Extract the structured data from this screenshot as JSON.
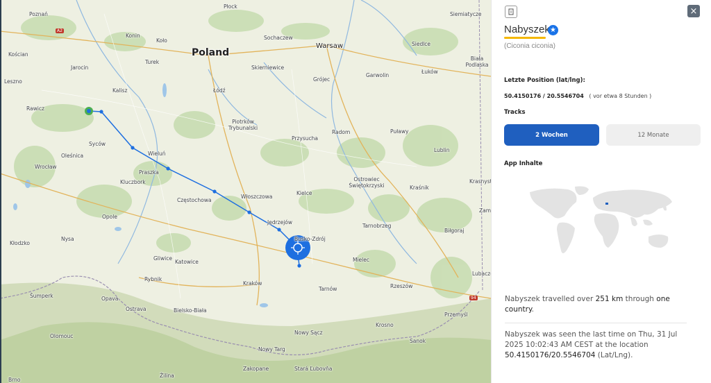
{
  "map": {
    "country_label": "Poland",
    "cities": [
      {
        "name": "Poznań",
        "size": "small"
      },
      {
        "name": "Konin",
        "size": "small"
      },
      {
        "name": "Koło",
        "size": "small"
      },
      {
        "name": "Sochaczew",
        "size": "small"
      },
      {
        "name": "Warsaw",
        "size": "mid"
      },
      {
        "name": "Siedlce",
        "size": "small"
      },
      {
        "name": "Biała Podlaska",
        "size": "small"
      },
      {
        "name": "Kościan",
        "size": "small"
      },
      {
        "name": "Jarocin",
        "size": "small"
      },
      {
        "name": "Turek",
        "size": "small"
      },
      {
        "name": "Skierniewice",
        "size": "small"
      },
      {
        "name": "Garwolin",
        "size": "small"
      },
      {
        "name": "Łuków",
        "size": "small"
      },
      {
        "name": "Leszno",
        "size": "small"
      },
      {
        "name": "Kalisz",
        "size": "small"
      },
      {
        "name": "Łódź",
        "size": "small"
      },
      {
        "name": "Grójec",
        "size": "small"
      },
      {
        "name": "Rawicz",
        "size": "small"
      },
      {
        "name": "Piotrków Trybunalski",
        "size": "small"
      },
      {
        "name": "Radom",
        "size": "small"
      },
      {
        "name": "Puławy",
        "size": "small"
      },
      {
        "name": "Syców",
        "size": "small"
      },
      {
        "name": "Przysucha",
        "size": "small"
      },
      {
        "name": "Oleśnica",
        "size": "small"
      },
      {
        "name": "Wieluń",
        "size": "small"
      },
      {
        "name": "Lublin",
        "size": "small"
      },
      {
        "name": "Wrocław",
        "size": "small"
      },
      {
        "name": "Praszka",
        "size": "small"
      },
      {
        "name": "Kluczbork",
        "size": "small"
      },
      {
        "name": "Ostrowiec Świętokrzyski",
        "size": "small"
      },
      {
        "name": "Kraśnik",
        "size": "small"
      },
      {
        "name": "Krasnystaw",
        "size": "small"
      },
      {
        "name": "Częstochowa",
        "size": "small"
      },
      {
        "name": "Włoszczowa",
        "size": "small"
      },
      {
        "name": "Kielce",
        "size": "small"
      },
      {
        "name": "Opole",
        "size": "small"
      },
      {
        "name": "Jędrzejów",
        "size": "small"
      },
      {
        "name": "Tarnobrzeg",
        "size": "small"
      },
      {
        "name": "Biłgoraj",
        "size": "small"
      },
      {
        "name": "Zamość",
        "size": "small"
      },
      {
        "name": "Nysa",
        "size": "small"
      },
      {
        "name": "Kłodzko",
        "size": "small"
      },
      {
        "name": "Busko-Zdrój",
        "size": "small"
      },
      {
        "name": "Gliwice",
        "size": "small"
      },
      {
        "name": "Katowice",
        "size": "small"
      },
      {
        "name": "Mielec",
        "size": "small"
      },
      {
        "name": "Rybnik",
        "size": "small"
      },
      {
        "name": "Lubaczów",
        "size": "small"
      },
      {
        "name": "Kraków",
        "size": "small"
      },
      {
        "name": "Tarnów",
        "size": "small"
      },
      {
        "name": "Rzeszów",
        "size": "small"
      },
      {
        "name": "Šumperk",
        "size": "small"
      },
      {
        "name": "Opava",
        "size": "small"
      },
      {
        "name": "Ostrava",
        "size": "small"
      },
      {
        "name": "Bielsko-Biała",
        "size": "small"
      },
      {
        "name": "Przemyśl",
        "size": "small"
      },
      {
        "name": "Krosno",
        "size": "small"
      },
      {
        "name": "Olomouc",
        "size": "small"
      },
      {
        "name": "Nowy Sącz",
        "size": "small"
      },
      {
        "name": "Sanok",
        "size": "small"
      },
      {
        "name": "Nowy Targ",
        "size": "small"
      },
      {
        "name": "Zakopane",
        "size": "small"
      },
      {
        "name": "Stará Ľubovňa",
        "size": "small"
      },
      {
        "name": "Brno",
        "size": "small"
      },
      {
        "name": "Žilina",
        "size": "small"
      },
      {
        "name": "Płock",
        "size": "small"
      },
      {
        "name": "Siemiatycze",
        "size": "small"
      }
    ],
    "road_shields": [
      "A2",
      "94"
    ],
    "track_color": "#1e6fe0",
    "start_marker_color": "#4caf50"
  },
  "panel": {
    "bird_name": "Nabyszek",
    "latin_name": "(Ciconia ciconia)",
    "last_position_label": "Letzte Position (lat/lng):",
    "last_position_value": "50.4150176 / 20.5546704",
    "last_position_ago": "( vor etwa 8 Stunden )",
    "tracks_label": "Tracks",
    "tab_2w": "2 Wochen",
    "tab_12m": "12 Monate",
    "app_content_label": "App Inhalte",
    "travel_text": {
      "before": "Nabyszek travelled over ",
      "distance": "251 km",
      "middle": " through ",
      "countries": "one country",
      "end": "."
    },
    "seen_text": {
      "before": "Nabyszek was seen the last time on Thu, 31 Jul 2025 10:02:43 AM CEST at the location ",
      "location": "50.4150176/20.5546704",
      "end": " (Lat/Lng)."
    },
    "accent_color": "#1f5fbf",
    "underline_color": "#f5b700"
  }
}
